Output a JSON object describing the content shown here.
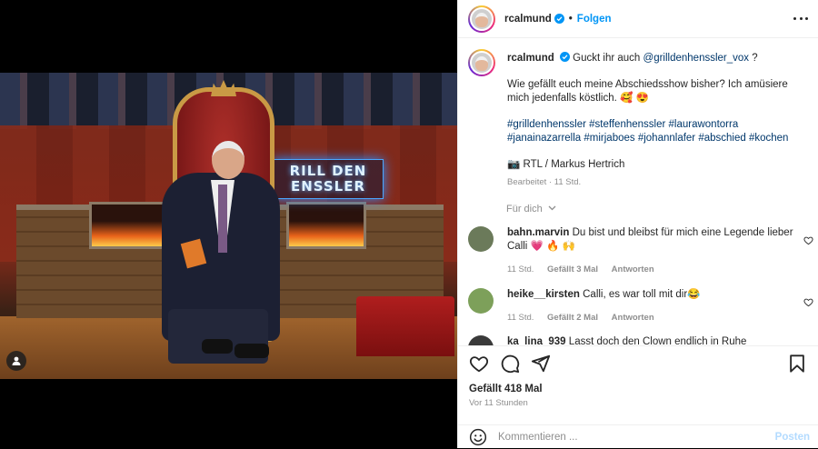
{
  "author": {
    "username": "rcalmund",
    "verified": true,
    "follow_label": "Folgen"
  },
  "caption": {
    "lead": "Guckt ihr auch",
    "mention": "@grilldenhenssler_vox",
    "lead_end": "?",
    "paragraph": "Wie gefällt euch meine Abschiedsshow bisher? Ich amüsiere mich jedenfalls köstlich. 🥰 😍",
    "hashtags": "#grilldenhenssler #steffenhenssler #laurawontorra #janainazarrella #mirjaboes #johannlafer #abschied #kochen",
    "credit": "📷 RTL / Markus Hertrich",
    "meta": "Bearbeitet · 11 Std."
  },
  "for_you_label": "Für dich",
  "comments": [
    {
      "user": "bahn.marvin",
      "text": "Du bist und bleibst für mich eine Legende lieber Calli 💗 🔥 🙌",
      "age": "11 Std.",
      "likes": "Gefällt 3 Mal",
      "reply": "Antworten",
      "avatar_color": "#6b7a5a"
    },
    {
      "user": "heike__kirsten",
      "text": "Calli, es war toll mit dir😂",
      "age": "11 Std.",
      "likes": "Gefällt 2 Mal",
      "reply": "Antworten",
      "avatar_color": "#7da05a"
    },
    {
      "user": "ka_lina_939",
      "text": "Lasst doch den Clown endlich in Ruhe",
      "age": "",
      "likes": "",
      "reply": "",
      "avatar_color": "#3a3a3a"
    }
  ],
  "stats": {
    "likes": "Gefällt 418 Mal",
    "time": "Vor 11 Stunden"
  },
  "comment_box": {
    "placeholder": "Kommentieren ...",
    "post_label": "Posten"
  },
  "media": {
    "sign_line1": "RILL DEN",
    "sign_line2": "ENSSLER"
  },
  "colors": {
    "link": "#00376b",
    "accent": "#0095f6",
    "muted": "#8e8e8e",
    "post_disabled": "#b3dbff"
  },
  "icons": [
    "heart-icon",
    "comment-icon",
    "share-icon",
    "bookmark-icon",
    "emoji-icon",
    "more-icon",
    "verified-icon",
    "user-tag-icon",
    "chevron-down-icon"
  ]
}
